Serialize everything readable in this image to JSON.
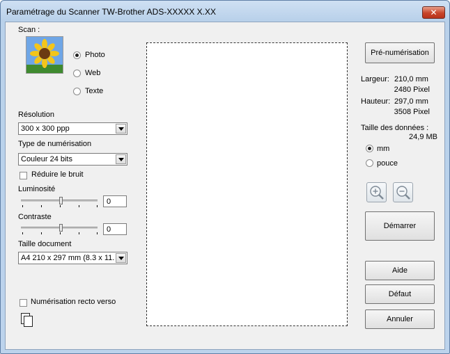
{
  "window": {
    "title": "Paramétrage du Scanner TW-Brother ADS-XXXXX X.XX",
    "close_label": "✕"
  },
  "scan": {
    "label": "Scan :",
    "modes": [
      {
        "label": "Photo",
        "selected": true
      },
      {
        "label": "Web",
        "selected": false
      },
      {
        "label": "Texte",
        "selected": false
      }
    ]
  },
  "resolution": {
    "label": "Résolution",
    "value": "300 x 300 ppp"
  },
  "scan_type": {
    "label": "Type de numérisation",
    "value": "Couleur 24 bits"
  },
  "noise": {
    "label": "Réduire le bruit",
    "checked": false
  },
  "brightness": {
    "label": "Luminosité",
    "value": "0"
  },
  "contrast": {
    "label": "Contraste",
    "value": "0"
  },
  "doc_size": {
    "label": "Taille document",
    "value": "A4 210 x 297 mm (8.3 x 11."
  },
  "duplex": {
    "label": "Numérisation recto verso",
    "checked": false
  },
  "info": {
    "width_label": "Largeur:",
    "width_mm": "210,0 mm",
    "width_px": "2480 Pixel",
    "height_label": "Hauteur:",
    "height_mm": "297,0 mm",
    "height_px": "3508 Pixel",
    "data_label": "Taille des données :",
    "data_value": "24,9 MB"
  },
  "units": [
    {
      "label": "mm",
      "selected": true
    },
    {
      "label": "pouce",
      "selected": false
    }
  ],
  "buttons": {
    "prescan": "Pré-numérisation",
    "start": "Démarrer",
    "help": "Aide",
    "default": "Défaut",
    "cancel": "Annuler"
  }
}
